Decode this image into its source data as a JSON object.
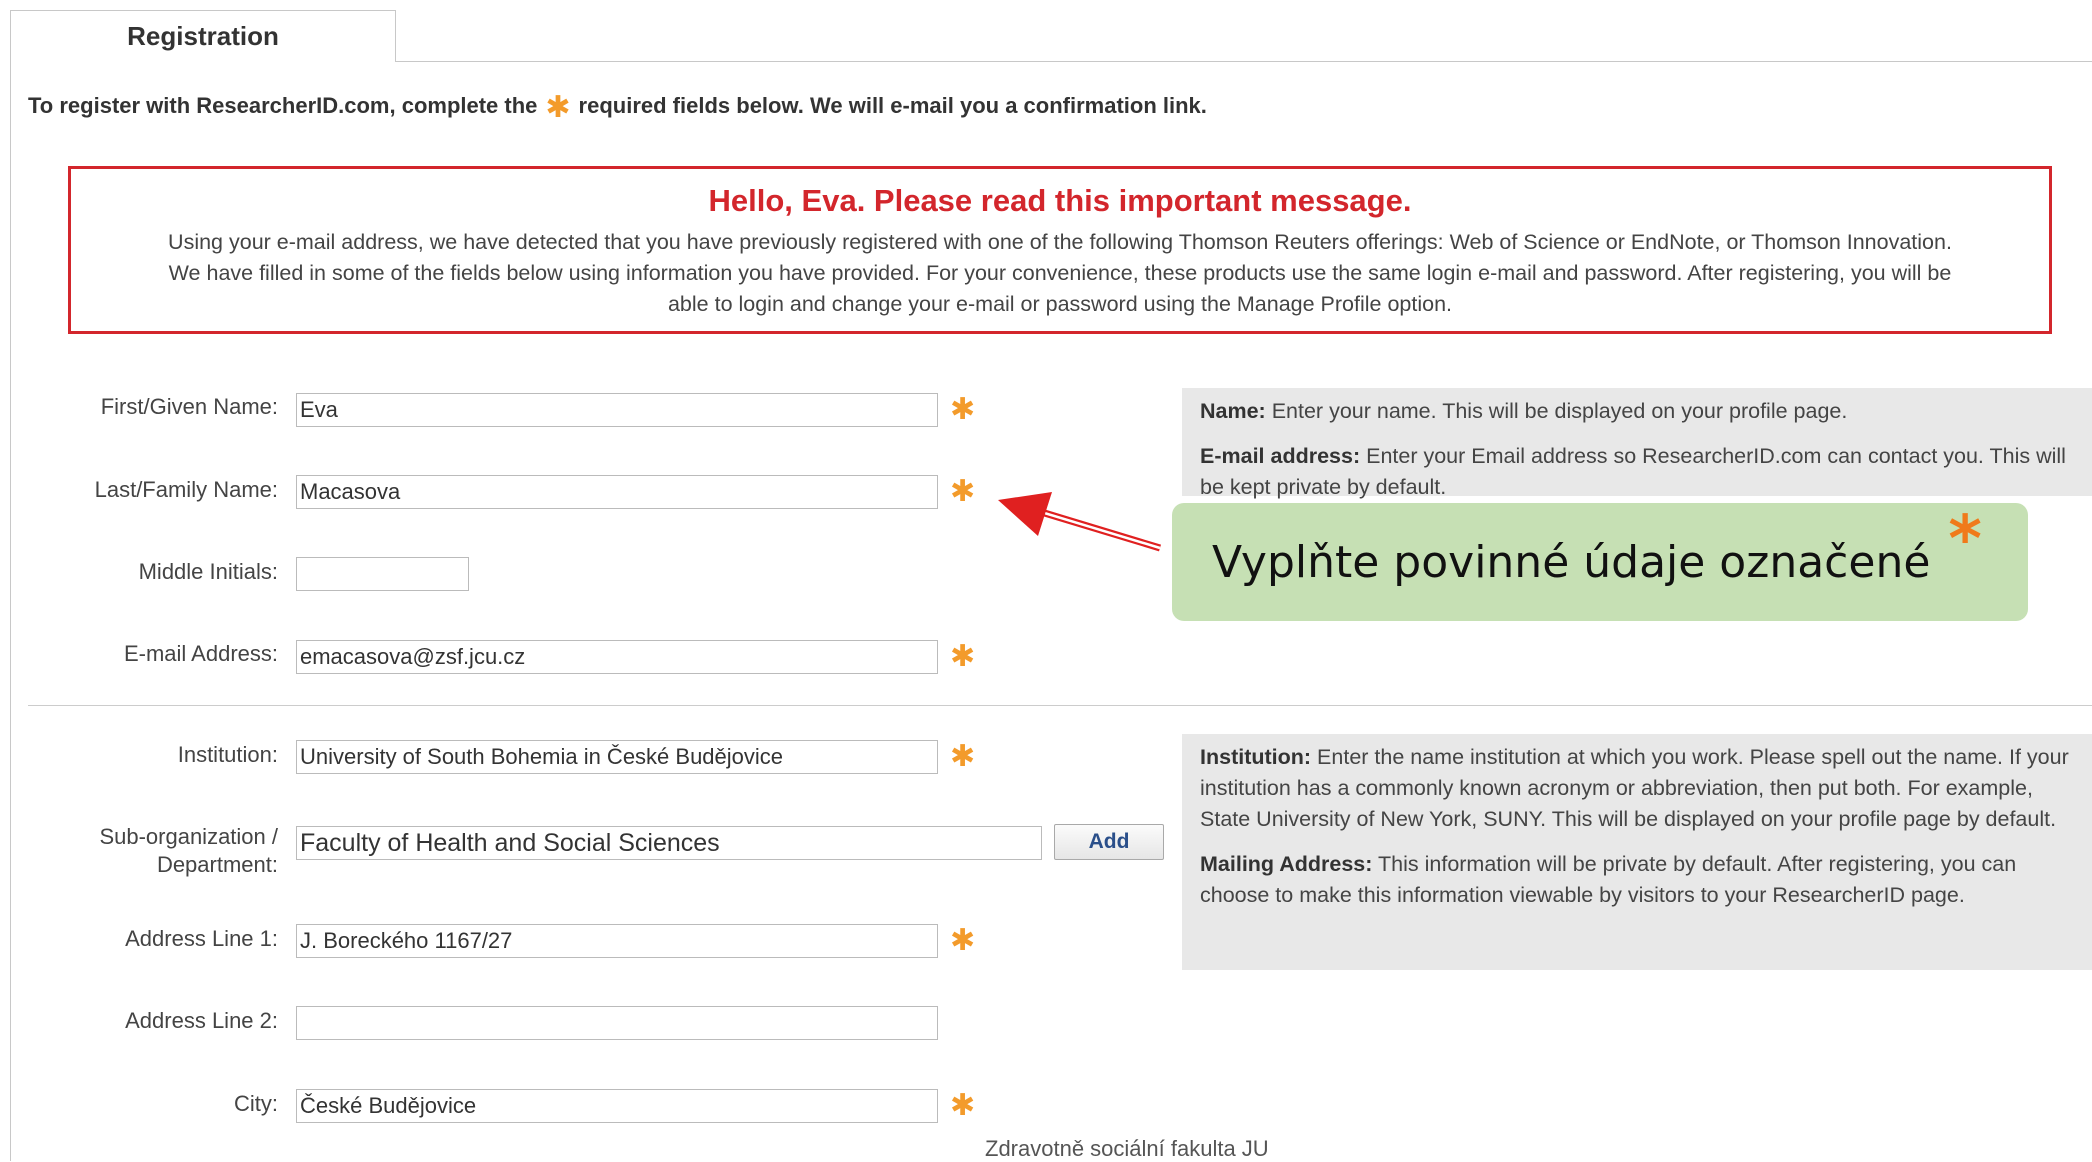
{
  "tab": {
    "label": "Registration"
  },
  "intro": {
    "before": "To register with ResearcherID.com, complete the",
    "star": "✱",
    "after": "required fields below. We will e-mail you a confirmation link."
  },
  "message": {
    "title": "Hello, Eva. Please read this important message.",
    "line1": "Using your e-mail address, we have detected that you have previously registered with one of the following Thomson Reuters offerings: Web of Science or EndNote, or Thomson Innovation.",
    "line2": "We have filled in some of the fields below using information you have provided. For your convenience, these products use the same login e-mail and password. After registering, you will be",
    "line3": "able to login and change your e-mail or password using the Manage Profile option."
  },
  "form": {
    "required_mark": "✱",
    "first_name": {
      "label": "First/Given Name:",
      "value": "Eva"
    },
    "last_name": {
      "label": "Last/Family Name:",
      "value": "Macasova"
    },
    "middle_initials": {
      "label": "Middle Initials:",
      "value": ""
    },
    "email": {
      "label": "E-mail Address:",
      "value": "emacasova@zsf.jcu.cz"
    },
    "institution": {
      "label": "Institution:",
      "value": "University of South Bohemia in České Budějovice"
    },
    "suborg": {
      "label_line1": "Sub-organization /",
      "label_line2": "Department:",
      "value": "Faculty of Health and Social Sciences"
    },
    "add_button": "Add",
    "address1": {
      "label": "Address Line 1:",
      "value": "J. Boreckého 1167/27"
    },
    "address2": {
      "label": "Address Line 2:",
      "value": ""
    },
    "city": {
      "label": "City:",
      "value": "České Budějovice"
    }
  },
  "help": {
    "name": {
      "title": "Name:",
      "text": "Enter your name. This will be displayed on your profile page."
    },
    "email": {
      "title": "E-mail address:",
      "text": "Enter your Email address so ResearcherID.com can contact you. This will be kept private by default."
    },
    "institution": {
      "title": "Institution:",
      "text": "Enter the name institution at which you work. Please spell out the name. If your institution has a commonly known acronym or abbreviation, then put both. For example, State University of New York, SUNY. This will be displayed on your profile page by default."
    },
    "mailing": {
      "title": "Mailing Address:",
      "text": "This information will be private by default. After registering, you can choose to make this information viewable by visitors to your ResearcherID page."
    }
  },
  "callout": {
    "text": "Vyplňte povinné údaje označené",
    "star": "*"
  },
  "footer": {
    "text": "Zdravotně sociální fakulta JU"
  },
  "colors": {
    "accent_red": "#d3262c",
    "required_orange": "#f39b2b",
    "callout_green": "#c6e0b4",
    "link_blue": "#2a4f8a"
  }
}
